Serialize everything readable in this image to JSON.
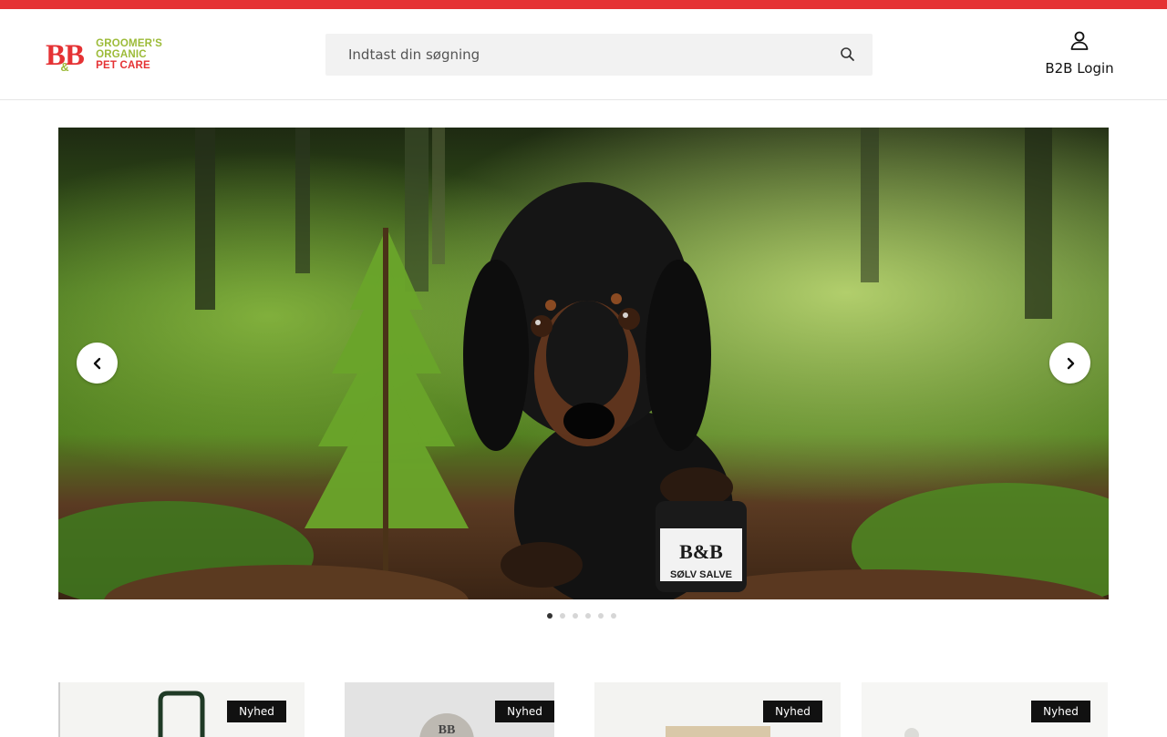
{
  "brand": {
    "logo_monogram": "B&B",
    "logo_line1": "GROOMER'S",
    "logo_line2": "ORGANIC",
    "logo_line3": "PET CARE",
    "accent_color": "#e53234",
    "secondary_color": "#9cbb38"
  },
  "search": {
    "placeholder": "Indtast din søgning",
    "icon": "search-icon"
  },
  "account": {
    "label": "B2B Login",
    "icon": "user-icon"
  },
  "hero": {
    "image": "dachshund-in-forest-with-jar",
    "jar_label": "SØLV SALVE",
    "jar_logo": "B&B",
    "prev_icon": "chevron-left-icon",
    "next_icon": "chevron-right-icon",
    "slide_count": 6,
    "active_slide": 1
  },
  "products": [
    {
      "badge": "Nyhed"
    },
    {
      "badge": "Nyhed"
    },
    {
      "badge": "Nyhed"
    },
    {
      "badge": "Nyhed"
    }
  ]
}
